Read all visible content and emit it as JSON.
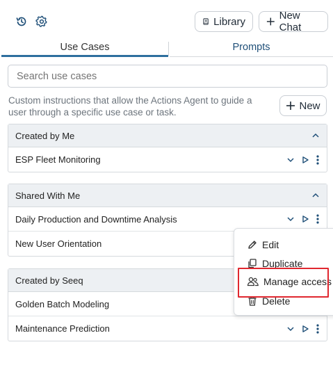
{
  "header": {
    "library_label": "Library",
    "new_chat_label": "New Chat"
  },
  "tabs": [
    {
      "label": "Use Cases",
      "active": true
    },
    {
      "label": "Prompts",
      "active": false
    }
  ],
  "search": {
    "placeholder": "Search use cases"
  },
  "description": "Custom instructions that allow the Actions Agent to guide a user through a specific use case or task.",
  "new_button_label": "New",
  "groups": [
    {
      "title": "Created by Me",
      "rows": [
        {
          "label": "ESP Fleet Monitoring"
        }
      ]
    },
    {
      "title": "Shared With Me",
      "rows": [
        {
          "label": "Daily Production and Downtime Analysis"
        },
        {
          "label": "New User Orientation"
        }
      ]
    },
    {
      "title": "Created by Seeq",
      "rows": [
        {
          "label": "Golden Batch Modeling"
        },
        {
          "label": "Maintenance Prediction"
        }
      ]
    }
  ],
  "context_menu": {
    "items": [
      {
        "label": "Edit",
        "icon": "pencil-icon"
      },
      {
        "label": "Duplicate",
        "icon": "duplicate-icon"
      },
      {
        "label": "Manage access",
        "icon": "users-icon",
        "highlighted": true
      },
      {
        "label": "Delete",
        "icon": "trash-icon"
      }
    ]
  },
  "colors": {
    "accent": "#2e6f9e",
    "highlight_border": "#e0272f",
    "header_bg": "#edf0f3",
    "icon_blue": "#1f4f78"
  }
}
